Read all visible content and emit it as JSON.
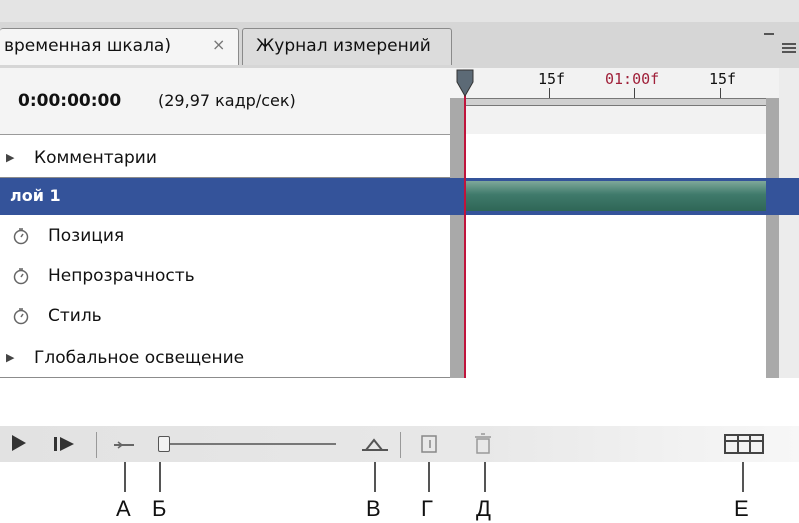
{
  "tabs": [
    {
      "label": "временная шкала)",
      "close": "×",
      "active": true
    },
    {
      "label": "Журнал измерений",
      "active": false
    }
  ],
  "header": {
    "timecode": "0:00:00:00",
    "fps": "(29,97 кадр/сек)"
  },
  "ruler": {
    "ticks": [
      "15f",
      "01:00f",
      "15f"
    ],
    "accent_tick_color": "#a0213a"
  },
  "rows": [
    {
      "label": "Комментарии",
      "icon": "twirl-arrow-icon"
    },
    {
      "label": "лой 1",
      "icon": "none",
      "selected": true
    },
    {
      "label": "Позиция",
      "icon": "stopwatch-icon"
    },
    {
      "label": "Непрозрачность",
      "icon": "stopwatch-icon"
    },
    {
      "label": "Стиль",
      "icon": "stopwatch-icon"
    },
    {
      "label": "Глобальное освещение",
      "icon": "twirl-arrow-icon"
    }
  ],
  "colors": {
    "selected_row": "#34539a",
    "layer_bar": "#3f7a6b",
    "playhead": "#c0143c"
  },
  "controls": {
    "icons": [
      "play-icon",
      "next-frame-icon",
      "zoom-out-icon",
      "zoom-slider",
      "zoom-in-icon",
      "new-layer-icon",
      "trash-icon",
      "animation-frames-icon"
    ]
  },
  "callouts": [
    "А",
    "Б",
    "В",
    "Г",
    "Д",
    "Е"
  ]
}
